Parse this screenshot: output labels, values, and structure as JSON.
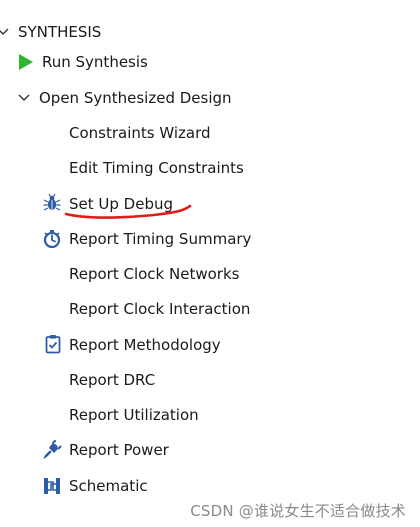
{
  "section": {
    "title": "SYNTHESIS",
    "run": "Run Synthesis",
    "open_design": "Open Synthesized Design"
  },
  "items": [
    {
      "label": "Constraints Wizard",
      "icon": "none"
    },
    {
      "label": "Edit Timing Constraints",
      "icon": "none"
    },
    {
      "label": "Set Up Debug",
      "icon": "bug-icon"
    },
    {
      "label": "Report Timing Summary",
      "icon": "stopwatch-icon"
    },
    {
      "label": "Report Clock Networks",
      "icon": "none"
    },
    {
      "label": "Report Clock Interaction",
      "icon": "none"
    },
    {
      "label": "Report Methodology",
      "icon": "clipboard-check-icon"
    },
    {
      "label": "Report DRC",
      "icon": "none"
    },
    {
      "label": "Report Utilization",
      "icon": "none"
    },
    {
      "label": "Report Power",
      "icon": "power-plug-icon"
    },
    {
      "label": "Schematic",
      "icon": "schematic-icon"
    }
  ],
  "colors": {
    "run_green": "#2fb52f",
    "icon_blue": "#2d5da8",
    "annotation_red": "#e31b1b",
    "watermark": "#8a8a8a"
  },
  "watermark": "CSDN @谁说女生不适合做技术"
}
